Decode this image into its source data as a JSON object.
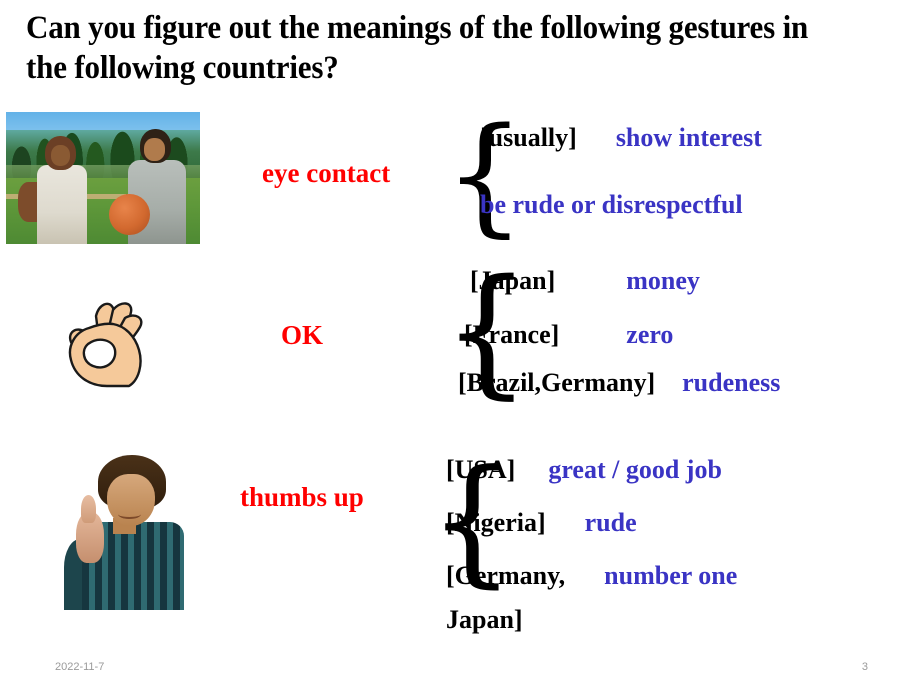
{
  "slide": {
    "title": "Can you figure out the meanings of  the following gestures in the following countries?",
    "footer_date": "2022-11-7",
    "footer_page": "3",
    "colors": {
      "gesture_label": "#ff0000",
      "meaning_text": "#3a34c4",
      "country_text": "#000000",
      "footer_text": "#9a9a9a",
      "background": "#ffffff"
    }
  },
  "rows": [
    {
      "gesture": "eye contact",
      "image_name": "photo-two-men-basketball",
      "entries": [
        {
          "country": "[usually]",
          "meaning": "show interest"
        },
        {
          "country": "",
          "meaning": "be rude or disrespectful"
        }
      ]
    },
    {
      "gesture": "OK",
      "image_name": "clipart-ok-hand-gesture",
      "entries": [
        {
          "country": "[Japan]",
          "meaning": "money"
        },
        {
          "country": "[France]",
          "meaning": "zero"
        },
        {
          "country": "[Brazil,Germany]",
          "meaning": "rudeness"
        }
      ]
    },
    {
      "gesture": "thumbs up",
      "image_name": "photo-person-thumbs-up",
      "entries": [
        {
          "country": "[USA]",
          "meaning": "great / good job"
        },
        {
          "country": "[Nigeria]",
          "meaning": "rude"
        },
        {
          "country": "[Germany,",
          "meaning": "number one"
        },
        {
          "country": "Japan]",
          "meaning": ""
        }
      ]
    }
  ],
  "braces": {
    "glyph": "{"
  }
}
